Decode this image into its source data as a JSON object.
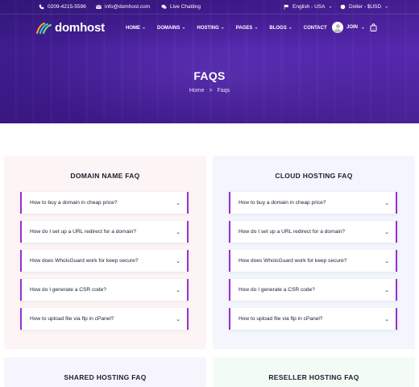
{
  "topbar": {
    "phone": "0209-4215-5596",
    "email": "info@domhost.com",
    "chat": "Live Chatting",
    "language": "English - USA",
    "currency": "Doller - $USD"
  },
  "brand": {
    "name": "domhost"
  },
  "nav": {
    "items": [
      "HOME",
      "DOMAINS",
      "HOSTING",
      "PAGES",
      "BLOGS",
      "CONTACT"
    ],
    "join": "JOIN"
  },
  "hero": {
    "title": "FAQS",
    "breadcrumb": [
      "Home",
      "Faqs"
    ],
    "separator": ">"
  },
  "sections": [
    {
      "title": "DOMAIN NAME FAQ",
      "questions": [
        "How to buy a domain in cheap price?",
        "How do I set up a URL redirect for a domain?",
        "How does WhoisGuard work for keep secure?",
        "How do I generate a CSR code?",
        "How to upload file via ftp in cPanel?"
      ]
    },
    {
      "title": "CLOUD HOSTING FAQ",
      "questions": [
        "How to buy a domain in cheap price?",
        "How do I set up a URL redirect for a domain?",
        "How does WhoisGuard work for keep secure?",
        "How do I generate a CSR code?",
        "How to upload file via ftp in cPanel?"
      ]
    },
    {
      "title": "SHARED HOSTING FAQ",
      "questions": []
    },
    {
      "title": "RESELLER HOSTING FAQ",
      "questions": []
    }
  ],
  "colors": {
    "hero": "#4b1fa0",
    "accent": "#9a2fd0"
  }
}
